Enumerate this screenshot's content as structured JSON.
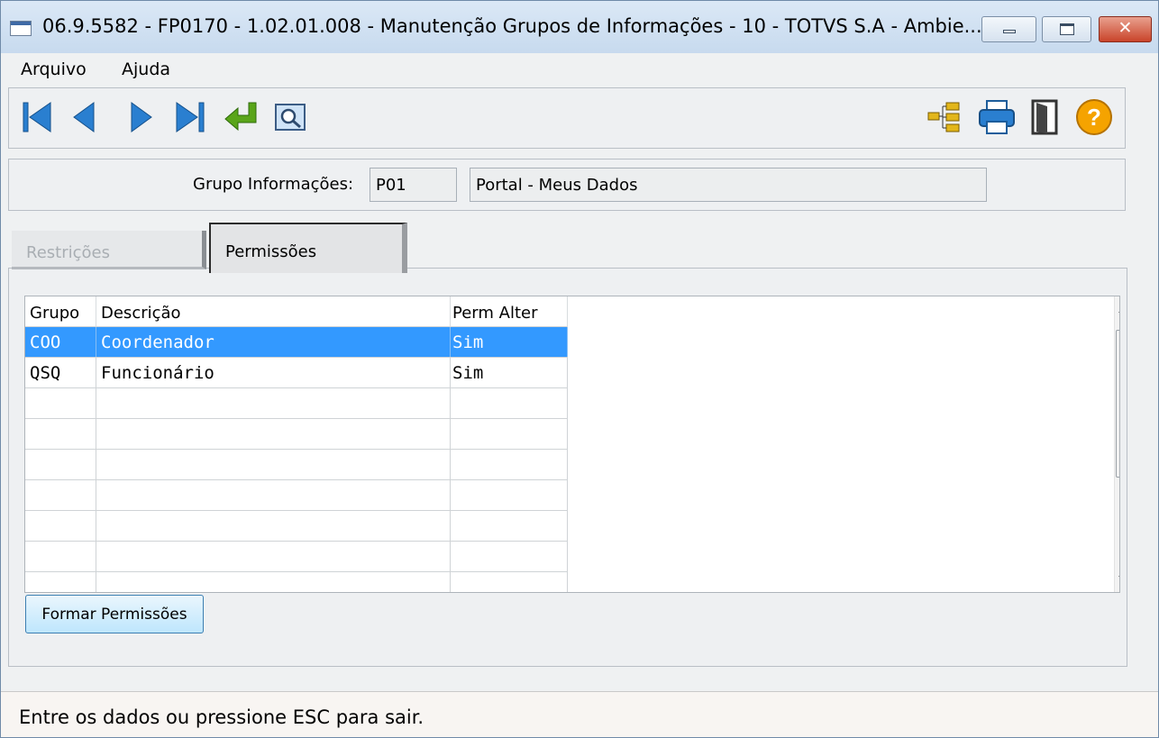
{
  "window": {
    "title": "06.9.5582 - FP0170 - 1.02.01.008 - Manutenção Grupos de Informações - 10 - TOTVS S.A - Ambie...",
    "close_glyph": "✕"
  },
  "menu": {
    "items": [
      "Arquivo",
      "Ajuda"
    ]
  },
  "toolbar": {
    "icons": [
      "first-record-icon",
      "previous-record-icon",
      "next-record-icon",
      "last-record-icon",
      "goto-icon",
      "search-icon",
      "tree-icon",
      "print-icon",
      "exit-door-icon",
      "help-icon"
    ]
  },
  "group": {
    "label": "Grupo Informações:",
    "code": "P01",
    "description": "Portal - Meus Dados"
  },
  "tabs": [
    {
      "label": "Restrições",
      "active": false
    },
    {
      "label": "Permissões",
      "active": true
    }
  ],
  "grid": {
    "columns": [
      "Grupo",
      "Descrição",
      "Perm Alter"
    ],
    "rows": [
      {
        "grupo": "COO",
        "descricao": "Coordenador",
        "perm": "Sim",
        "selected": true
      },
      {
        "grupo": "QSQ",
        "descricao": "Funcionário",
        "perm": "Sim",
        "selected": false
      },
      {
        "grupo": "",
        "descricao": "",
        "perm": ""
      },
      {
        "grupo": "",
        "descricao": "",
        "perm": ""
      },
      {
        "grupo": "",
        "descricao": "",
        "perm": ""
      },
      {
        "grupo": "",
        "descricao": "",
        "perm": ""
      },
      {
        "grupo": "",
        "descricao": "",
        "perm": ""
      },
      {
        "grupo": "",
        "descricao": "",
        "perm": ""
      }
    ]
  },
  "buttons": {
    "form_permissions": "Formar Permissões"
  },
  "status": {
    "text": "Entre os dados ou pressione ESC para sair."
  },
  "colors": {
    "selection": "#3399ff",
    "nav_blue": "#2a7fd0",
    "enter_green": "#5aa51a",
    "help_orange": "#f5a300"
  }
}
